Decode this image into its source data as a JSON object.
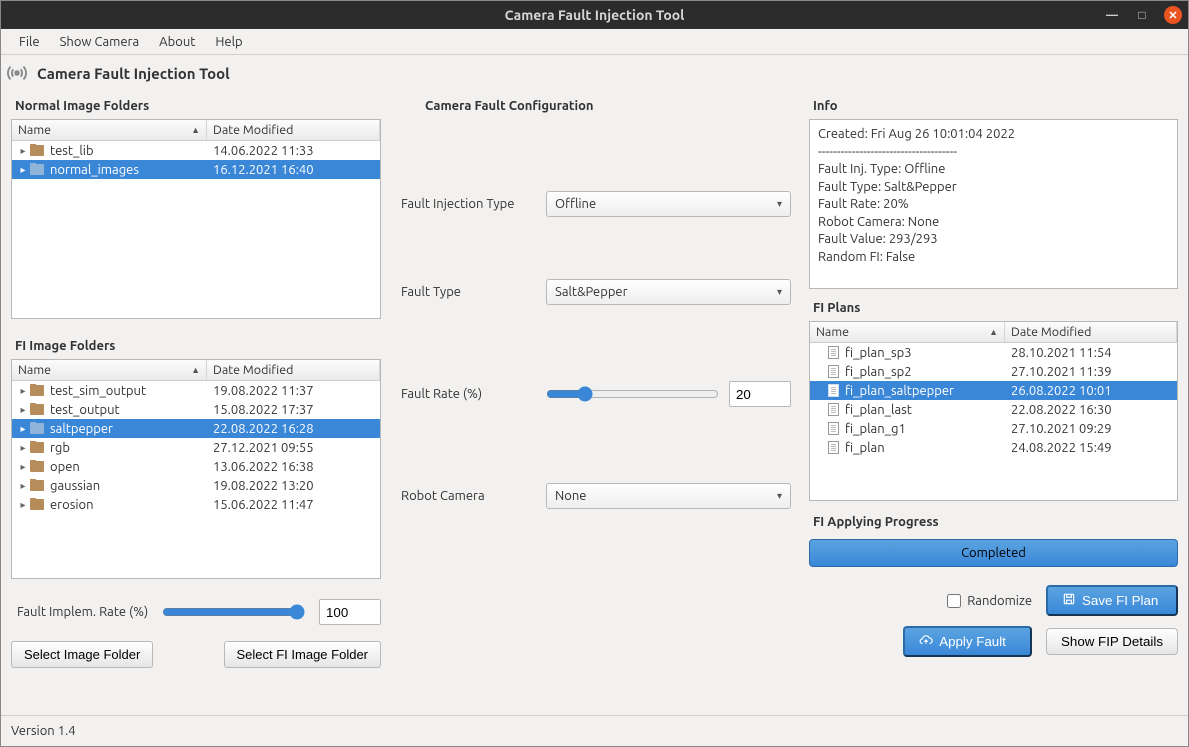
{
  "window_title": "Camera Fault Injection Tool",
  "menu": [
    "File",
    "Show Camera",
    "About",
    "Help"
  ],
  "app_title": "Camera Fault Injection Tool",
  "labels": {
    "normal_folders": "Normal Image Folders",
    "fi_folders": "FI Image Folders",
    "camera_config": "Camera Fault Configuration",
    "info": "Info",
    "fi_plans": "FI Plans",
    "fi_progress": "FI Applying Progress",
    "fault_injection_type": "Fault Injection Type",
    "fault_type": "Fault Type",
    "fault_rate": "Fault Rate (%)",
    "robot_camera": "Robot Camera",
    "fault_impl_rate": "Fault Implem. Rate (%)",
    "col_name": "Name",
    "col_date": "Date Modified"
  },
  "normal_folders": [
    {
      "name": "test_lib",
      "date": "14.06.2022 11:33",
      "sel": false
    },
    {
      "name": "normal_images",
      "date": "16.12.2021 16:40",
      "sel": true
    }
  ],
  "fi_folders": [
    {
      "name": "test_sim_output",
      "date": "19.08.2022 11:37",
      "sel": false
    },
    {
      "name": "test_output",
      "date": "15.08.2022 17:37",
      "sel": false
    },
    {
      "name": "saltpepper",
      "date": "22.08.2022 16:28",
      "sel": true
    },
    {
      "name": "rgb",
      "date": "27.12.2021 09:55",
      "sel": false
    },
    {
      "name": "open",
      "date": "13.06.2022 16:38",
      "sel": false
    },
    {
      "name": "gaussian",
      "date": "19.08.2022 13:20",
      "sel": false
    },
    {
      "name": "erosion",
      "date": "15.06.2022 11:47",
      "sel": false
    }
  ],
  "fi_plans": [
    {
      "name": "fi_plan_sp3",
      "date": "28.10.2021 11:54",
      "sel": false
    },
    {
      "name": "fi_plan_sp2",
      "date": "27.10.2021 11:39",
      "sel": false
    },
    {
      "name": "fi_plan_saltpepper",
      "date": "26.08.2022 10:01",
      "sel": true
    },
    {
      "name": "fi_plan_last",
      "date": "22.08.2022 16:30",
      "sel": false
    },
    {
      "name": "fi_plan_g1",
      "date": "27.10.2021 09:29",
      "sel": false
    },
    {
      "name": "fi_plan",
      "date": "24.08.2022 15:49",
      "sel": false
    }
  ],
  "config": {
    "fault_injection_type": "Offline",
    "fault_type": "Salt&Pepper",
    "fault_rate": "20",
    "robot_camera": "None",
    "fault_impl_rate": "100"
  },
  "info": {
    "created": "Created: Fri Aug 26 10:01:04 2022",
    "sep": "-------------------------------------",
    "l1": "Fault Inj. Type: Offline",
    "l2": "Fault Type: Salt&Pepper",
    "l3": "Fault Rate: 20%",
    "l4": "Robot Camera: None",
    "l5": "Fault Value: 293/293",
    "l6": "Random FI: False"
  },
  "progress_text": "Completed",
  "buttons": {
    "select_image_folder": "Select Image Folder",
    "select_fi_folder": "Select FI Image Folder",
    "randomize": "Randomize",
    "save_fi_plan": "Save FI Plan",
    "apply_fault": "Apply Fault",
    "show_fip_details": "Show FIP Details"
  },
  "status": "Version 1.4"
}
